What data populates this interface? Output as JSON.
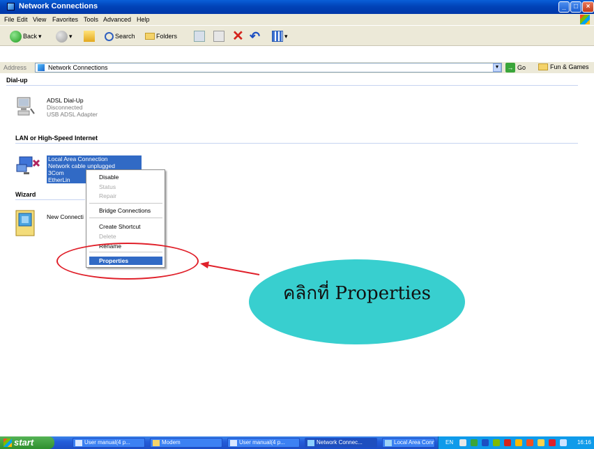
{
  "window": {
    "title": "Network Connections"
  },
  "menu": [
    "File",
    "Edit",
    "View",
    "Favorites",
    "Tools",
    "Advanced",
    "Help"
  ],
  "toolbar": {
    "back": "Back",
    "search": "Search",
    "folders": "Folders"
  },
  "address": {
    "label": "Address",
    "value": "Network Connections",
    "go": "Go",
    "links": "Fun & Games"
  },
  "groups": {
    "dialup": {
      "heading": "Dial-up",
      "item": {
        "name": "ADSL Dial-Up",
        "status": "Disconnected",
        "device": "USB ADSL Adapter"
      }
    },
    "lan": {
      "heading": "LAN or High-Speed Internet",
      "item": {
        "name": "Local Area Connection",
        "status": "Network cable unplugged",
        "device": "3Com EtherLin"
      }
    },
    "wizard": {
      "heading": "Wizard",
      "item": {
        "name": "New Connecti"
      }
    }
  },
  "context_menu": {
    "disable": "Disable",
    "status": "Status",
    "repair": "Repair",
    "bridge": "Bridge Connections",
    "shortcut": "Create Shortcut",
    "delete": "Delete",
    "rename": "Rename",
    "properties": "Properties"
  },
  "annotation": {
    "callout": "คลิกที่ Properties"
  },
  "taskbar": {
    "start": "start",
    "tasks": [
      "User manual(4 p...",
      "Modem",
      "User manual(4 p...",
      "Network Connec...",
      "Local Area Conn..."
    ],
    "lang": "EN",
    "clock": "16:16"
  }
}
